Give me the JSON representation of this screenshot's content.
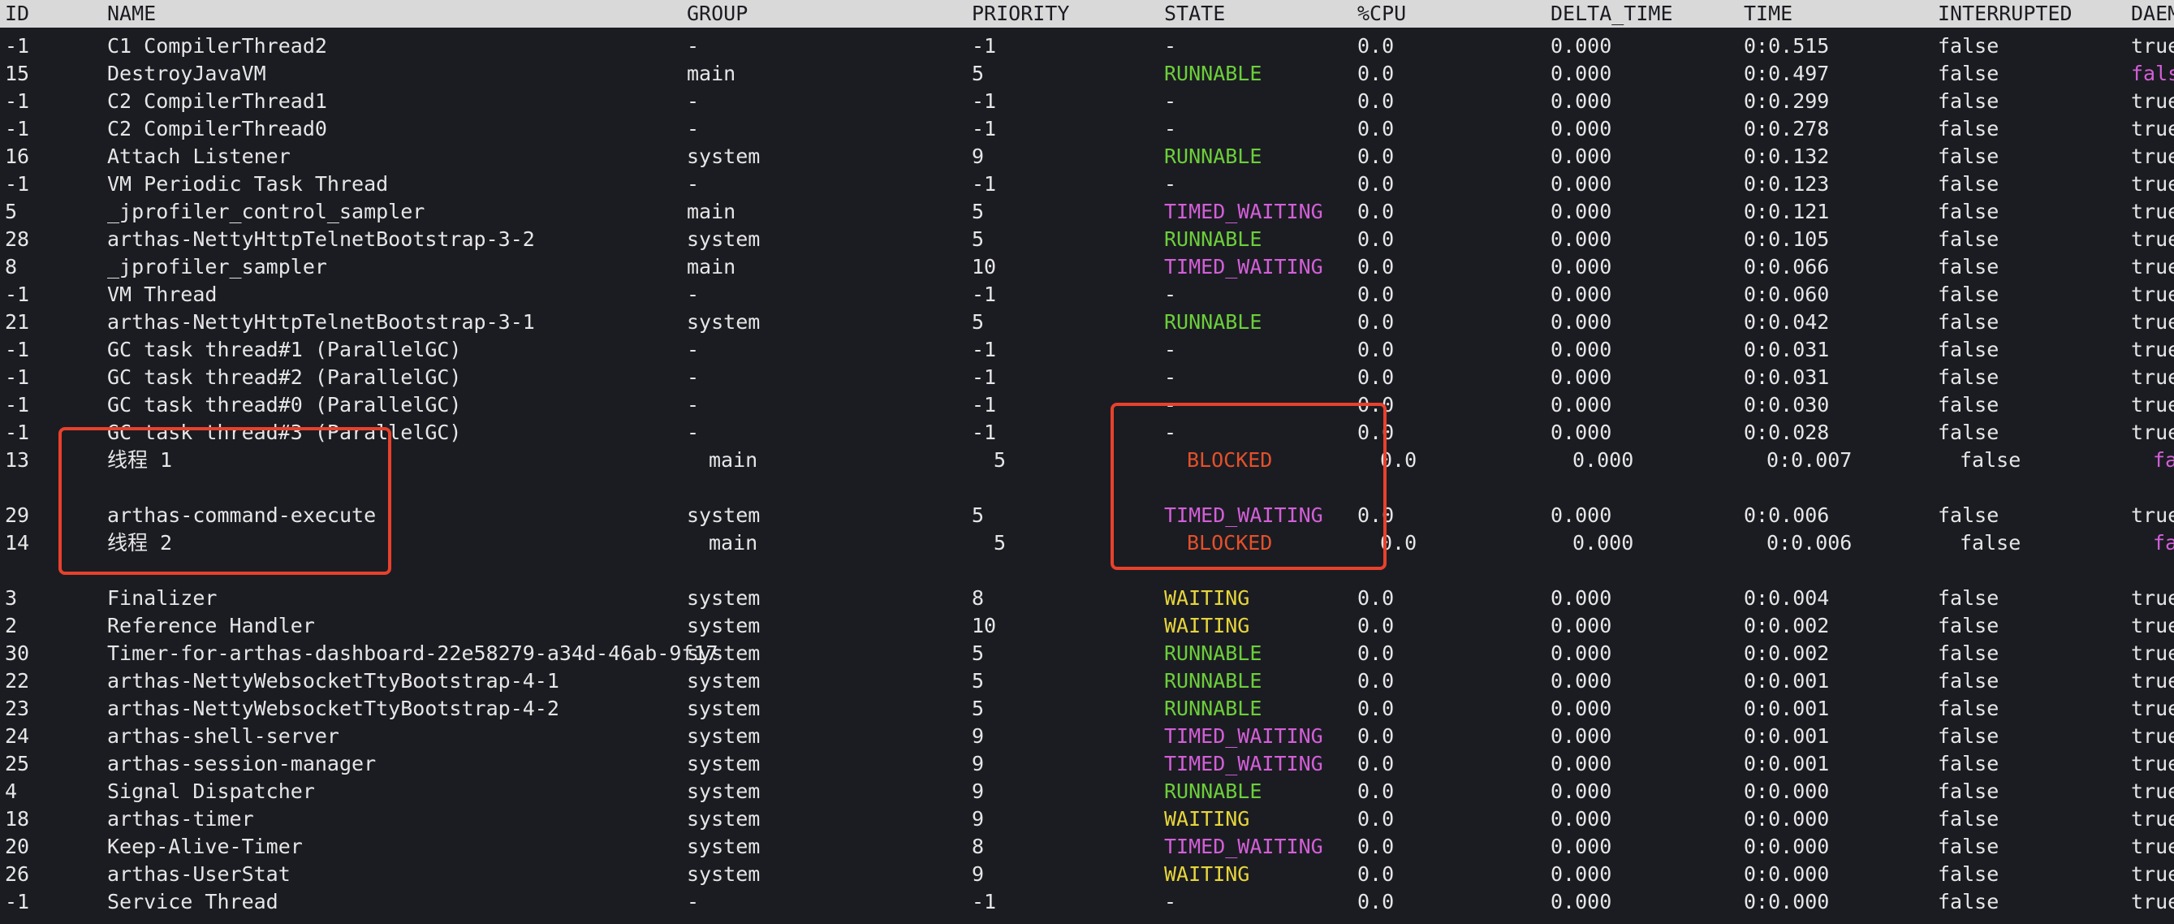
{
  "columns": {
    "id": "ID",
    "name": "NAME",
    "group": "GROUP",
    "priority": "PRIORITY",
    "state": "STATE",
    "cpu": "%CPU",
    "delta_time": "DELTA_TIME",
    "time": "TIME",
    "interrupted": "INTERRUPTED",
    "daemon": "DAEM"
  },
  "rows": [
    {
      "id": "-1",
      "name": "C1 CompilerThread2",
      "group": "-",
      "priority": "-1",
      "state": "-",
      "cpu": "0.0",
      "delta_time": "0.000",
      "time": "0:0.515",
      "interrupted": "false",
      "daemon": "true"
    },
    {
      "id": "15",
      "name": "DestroyJavaVM",
      "group": "main",
      "priority": "5",
      "state": "RUNNABLE",
      "cpu": "0.0",
      "delta_time": "0.000",
      "time": "0:0.497",
      "interrupted": "false",
      "daemon": "fals"
    },
    {
      "id": "-1",
      "name": "C2 CompilerThread1",
      "group": "-",
      "priority": "-1",
      "state": "-",
      "cpu": "0.0",
      "delta_time": "0.000",
      "time": "0:0.299",
      "interrupted": "false",
      "daemon": "true"
    },
    {
      "id": "-1",
      "name": "C2 CompilerThread0",
      "group": "-",
      "priority": "-1",
      "state": "-",
      "cpu": "0.0",
      "delta_time": "0.000",
      "time": "0:0.278",
      "interrupted": "false",
      "daemon": "true"
    },
    {
      "id": "16",
      "name": "Attach Listener",
      "group": "system",
      "priority": "9",
      "state": "RUNNABLE",
      "cpu": "0.0",
      "delta_time": "0.000",
      "time": "0:0.132",
      "interrupted": "false",
      "daemon": "true"
    },
    {
      "id": "-1",
      "name": "VM Periodic Task Thread",
      "group": "-",
      "priority": "-1",
      "state": "-",
      "cpu": "0.0",
      "delta_time": "0.000",
      "time": "0:0.123",
      "interrupted": "false",
      "daemon": "true"
    },
    {
      "id": "5",
      "name": "_jprofiler_control_sampler",
      "group": "main",
      "priority": "5",
      "state": "TIMED_WAITING",
      "cpu": "0.0",
      "delta_time": "0.000",
      "time": "0:0.121",
      "interrupted": "false",
      "daemon": "true"
    },
    {
      "id": "28",
      "name": "arthas-NettyHttpTelnetBootstrap-3-2",
      "group": "system",
      "priority": "5",
      "state": "RUNNABLE",
      "cpu": "0.0",
      "delta_time": "0.000",
      "time": "0:0.105",
      "interrupted": "false",
      "daemon": "true"
    },
    {
      "id": "8",
      "name": "_jprofiler_sampler",
      "group": "main",
      "priority": "10",
      "state": "TIMED_WAITING",
      "cpu": "0.0",
      "delta_time": "0.000",
      "time": "0:0.066",
      "interrupted": "false",
      "daemon": "true"
    },
    {
      "id": "-1",
      "name": "VM Thread",
      "group": "-",
      "priority": "-1",
      "state": "-",
      "cpu": "0.0",
      "delta_time": "0.000",
      "time": "0:0.060",
      "interrupted": "false",
      "daemon": "true"
    },
    {
      "id": "21",
      "name": "arthas-NettyHttpTelnetBootstrap-3-1",
      "group": "system",
      "priority": "5",
      "state": "RUNNABLE",
      "cpu": "0.0",
      "delta_time": "0.000",
      "time": "0:0.042",
      "interrupted": "false",
      "daemon": "true"
    },
    {
      "id": "-1",
      "name": "GC task thread#1 (ParallelGC)",
      "group": "-",
      "priority": "-1",
      "state": "-",
      "cpu": "0.0",
      "delta_time": "0.000",
      "time": "0:0.031",
      "interrupted": "false",
      "daemon": "true"
    },
    {
      "id": "-1",
      "name": "GC task thread#2 (ParallelGC)",
      "group": "-",
      "priority": "-1",
      "state": "-",
      "cpu": "0.0",
      "delta_time": "0.000",
      "time": "0:0.031",
      "interrupted": "false",
      "daemon": "true"
    },
    {
      "id": "-1",
      "name": "GC task thread#0 (ParallelGC)",
      "group": "-",
      "priority": "-1",
      "state": "-",
      "cpu": "0.0",
      "delta_time": "0.000",
      "time": "0:0.030",
      "interrupted": "false",
      "daemon": "true"
    },
    {
      "id": "-1",
      "name": "GC task thread#3 (ParallelGC)",
      "group": "-",
      "priority": "-1",
      "state": "-",
      "cpu": "0.0",
      "delta_time": "0.000",
      "time": "0:0.028",
      "interrupted": "false",
      "daemon": "true"
    },
    {
      "id": "13",
      "name": "线程 1",
      "group": "main",
      "priority": "5",
      "state": "BLOCKED",
      "cpu": "0.0",
      "delta_time": "0.000",
      "time": "0:0.007",
      "interrupted": "false",
      "daemon": "fa"
    },
    {
      "id": "29",
      "name": "arthas-command-execute",
      "group": "system",
      "priority": "5",
      "state": "TIMED_WAITING",
      "cpu": "0.0",
      "delta_time": "0.000",
      "time": "0:0.006",
      "interrupted": "false",
      "daemon": "true"
    },
    {
      "id": "14",
      "name": "线程 2",
      "group": "main",
      "priority": "5",
      "state": "BLOCKED",
      "cpu": "0.0",
      "delta_time": "0.000",
      "time": "0:0.006",
      "interrupted": "false",
      "daemon": "fa"
    },
    {
      "id": "3",
      "name": "Finalizer",
      "group": "system",
      "priority": "8",
      "state": "WAITING",
      "cpu": "0.0",
      "delta_time": "0.000",
      "time": "0:0.004",
      "interrupted": "false",
      "daemon": "true"
    },
    {
      "id": "2",
      "name": "Reference Handler",
      "group": "system",
      "priority": "10",
      "state": "WAITING",
      "cpu": "0.0",
      "delta_time": "0.000",
      "time": "0:0.002",
      "interrupted": "false",
      "daemon": "true"
    },
    {
      "id": "30",
      "name": "Timer-for-arthas-dashboard-22e58279-a34d-46ab-9f17",
      "group": "system",
      "priority": "5",
      "state": "RUNNABLE",
      "cpu": "0.0",
      "delta_time": "0.000",
      "time": "0:0.002",
      "interrupted": "false",
      "daemon": "true"
    },
    {
      "id": "22",
      "name": "arthas-NettyWebsocketTtyBootstrap-4-1",
      "group": "system",
      "priority": "5",
      "state": "RUNNABLE",
      "cpu": "0.0",
      "delta_time": "0.000",
      "time": "0:0.001",
      "interrupted": "false",
      "daemon": "true"
    },
    {
      "id": "23",
      "name": "arthas-NettyWebsocketTtyBootstrap-4-2",
      "group": "system",
      "priority": "5",
      "state": "RUNNABLE",
      "cpu": "0.0",
      "delta_time": "0.000",
      "time": "0:0.001",
      "interrupted": "false",
      "daemon": "true"
    },
    {
      "id": "24",
      "name": "arthas-shell-server",
      "group": "system",
      "priority": "9",
      "state": "TIMED_WAITING",
      "cpu": "0.0",
      "delta_time": "0.000",
      "time": "0:0.001",
      "interrupted": "false",
      "daemon": "true"
    },
    {
      "id": "25",
      "name": "arthas-session-manager",
      "group": "system",
      "priority": "9",
      "state": "TIMED_WAITING",
      "cpu": "0.0",
      "delta_time": "0.000",
      "time": "0:0.001",
      "interrupted": "false",
      "daemon": "true"
    },
    {
      "id": "4",
      "name": "Signal Dispatcher",
      "group": "system",
      "priority": "9",
      "state": "RUNNABLE",
      "cpu": "0.0",
      "delta_time": "0.000",
      "time": "0:0.000",
      "interrupted": "false",
      "daemon": "true"
    },
    {
      "id": "18",
      "name": "arthas-timer",
      "group": "system",
      "priority": "9",
      "state": "WAITING",
      "cpu": "0.0",
      "delta_time": "0.000",
      "time": "0:0.000",
      "interrupted": "false",
      "daemon": "true"
    },
    {
      "id": "20",
      "name": "Keep-Alive-Timer",
      "group": "system",
      "priority": "8",
      "state": "TIMED_WAITING",
      "cpu": "0.0",
      "delta_time": "0.000",
      "time": "0:0.000",
      "interrupted": "false",
      "daemon": "true"
    },
    {
      "id": "26",
      "name": "arthas-UserStat",
      "group": "system",
      "priority": "9",
      "state": "WAITING",
      "cpu": "0.0",
      "delta_time": "0.000",
      "time": "0:0.000",
      "interrupted": "false",
      "daemon": "true"
    },
    {
      "id": "-1",
      "name": "Service Thread",
      "group": "-",
      "priority": "-1",
      "state": "-",
      "cpu": "0.0",
      "delta_time": "0.000",
      "time": "0:0.000",
      "interrupted": "false",
      "daemon": "true"
    }
  ]
}
